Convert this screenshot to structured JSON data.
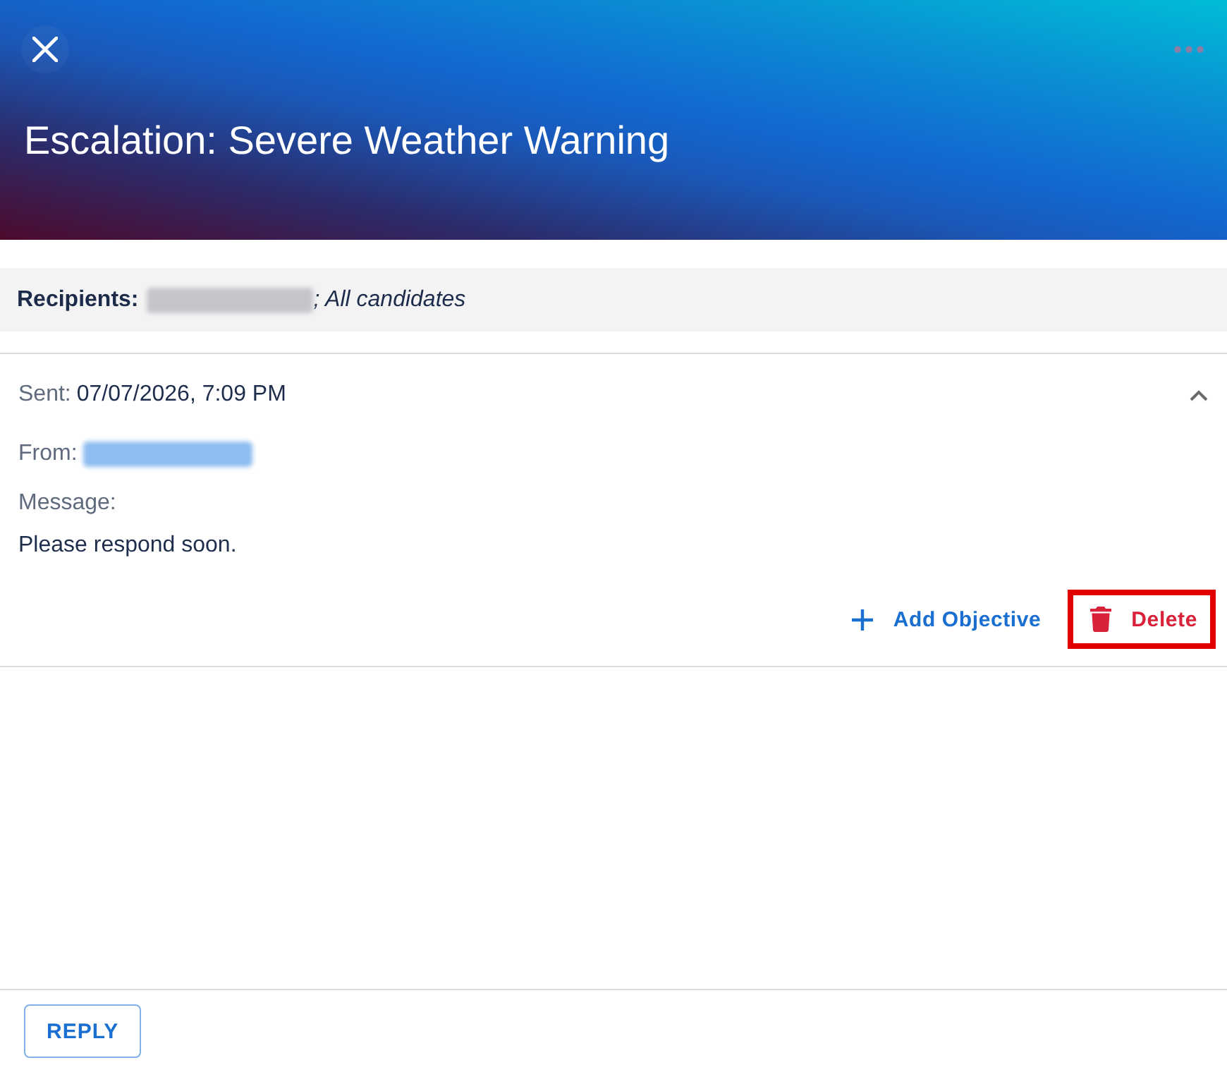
{
  "header": {
    "title": "Escalation: Severe Weather Warning"
  },
  "recipients": {
    "label": "Recipients:",
    "redacted_name": true,
    "text": "; All candidates"
  },
  "message": {
    "expanded": true,
    "sent_label": "Sent:",
    "sent_value": "07/07/2026, 7:09 PM",
    "from_label": "From:",
    "from_redacted": true,
    "message_label": "Message:",
    "body": "Please respond soon.",
    "actions": [
      {
        "kind": "add",
        "label": "Add Objective",
        "highlighted": false
      },
      {
        "kind": "delete",
        "label": "Delete",
        "highlighted": true
      }
    ]
  },
  "footer": {
    "buttons": [
      {
        "label": "REPLY"
      }
    ]
  }
}
